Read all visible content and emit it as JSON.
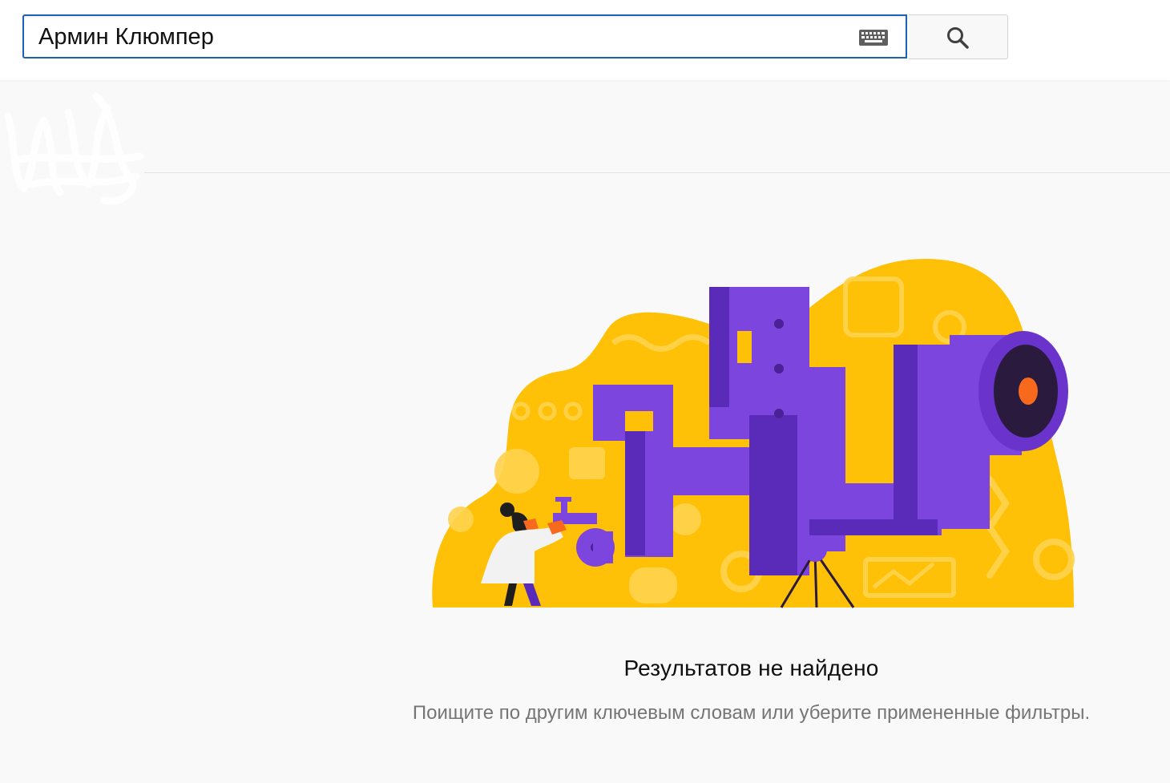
{
  "search": {
    "value": "Армин Клюмпер",
    "keyboard_icon": "keyboard-icon",
    "button_icon": "search-icon"
  },
  "empty_state": {
    "title": "Результатов не найдено",
    "hint": "Поищите по другим ключевым словам или уберите примененные фильтры."
  },
  "colors": {
    "focus_border": "#1c62b9",
    "illustration_yellow": "#ffc107",
    "illustration_purple": "#6c3bd0",
    "illustration_orange": "#f76a1e"
  }
}
